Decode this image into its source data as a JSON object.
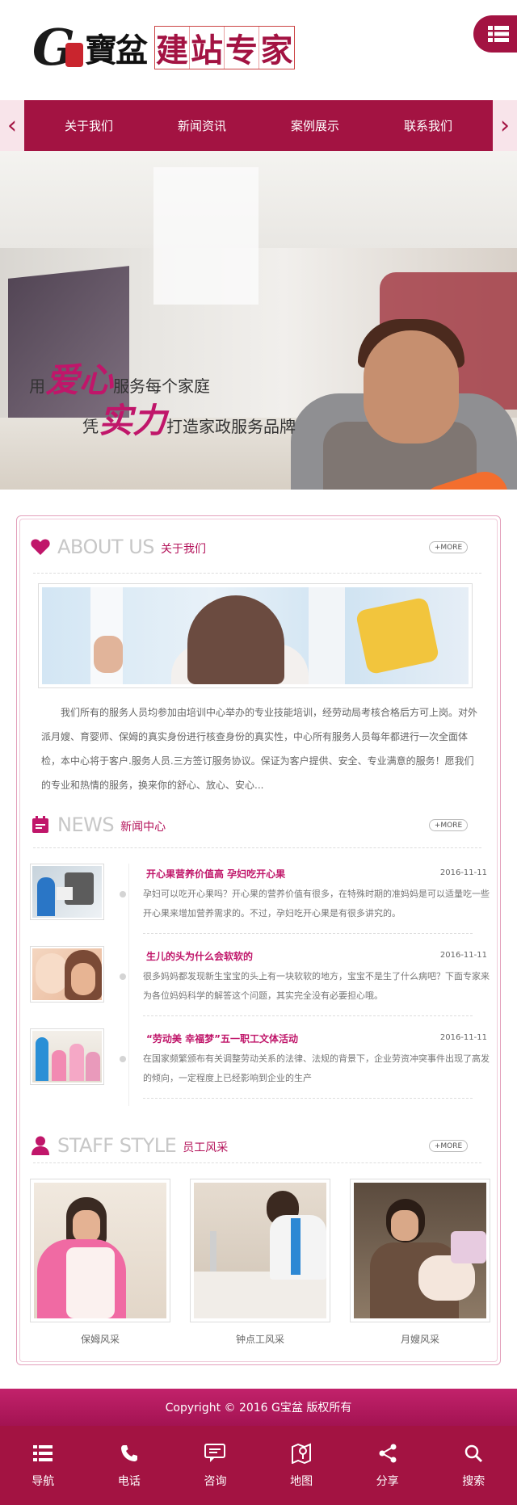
{
  "header": {
    "logo_letter": "G",
    "logo_bao": "寶盆",
    "logo_slogan_chars": [
      "建",
      "站",
      "专",
      "家"
    ]
  },
  "nav": {
    "items": [
      "关于我们",
      "新闻资讯",
      "案例展示",
      "联系我们"
    ],
    "prev_glyph": "‹",
    "next_glyph": "›"
  },
  "banner": {
    "line1_pre": "用",
    "line1_em": "爱心",
    "line1_post": "服务每个家庭",
    "line2_pre": "凭",
    "line2_em": "实力",
    "line2_post": "打造家政服务品牌"
  },
  "about": {
    "title_en": "ABOUT US",
    "title_cn": "关于我们",
    "more": "+MORE",
    "text": "我们所有的服务人员均参加由培训中心举办的专业技能培训，经劳动局考核合格后方可上岗。对外派月嫂、育婴师、保姆的真实身份进行核查身份的真实性，中心所有服务人员每年都进行一次全面体检，本中心将于客户.服务人员.三方签订服务协议。保证为客户提供、安全、专业满意的服务！愿我们的专业和热情的服务，换来你的舒心、放心、安心..."
  },
  "news": {
    "title_en": "NEWS",
    "title_cn": "新闻中心",
    "more": "+MORE",
    "items": [
      {
        "title": "开心果营养价值高 孕妇吃开心果",
        "date": "2016-11-11",
        "desc": "孕妇可以吃开心果吗？开心果的营养价值有很多，在特殊时期的准妈妈是可以适量吃一些开心果来增加营养需求的。不过，孕妇吃开心果是有很多讲究的。"
      },
      {
        "title": "生儿的头为什么会软软的",
        "date": "2016-11-11",
        "desc": "很多妈妈都发现新生宝宝的头上有一块软软的地方，宝宝不是生了什么病吧？下面专家来为各位妈妈科学的解答这个问题，其实完全没有必要担心哦。"
      },
      {
        "title": "“劳动美 幸福梦”五一职工文体活动",
        "date": "2016-11-11",
        "desc": "在国家频繁颁布有关调整劳动关系的法律、法规的背景下，企业劳资冲突事件出现了高发的倾向，一定程度上已经影响到企业的生产"
      }
    ]
  },
  "staff": {
    "title_en": "STAFF STYLE",
    "title_cn": "员工风采",
    "more": "+MORE",
    "items": [
      "保姆风采",
      "钟点工风采",
      "月嫂风采"
    ]
  },
  "footer": {
    "copyright": "Copyright © 2016 G宝盆 版权所有",
    "bottom_nav": [
      "导航",
      "电话",
      "咨询",
      "地图",
      "分享",
      "搜索"
    ]
  },
  "colors": {
    "brand": "#a31342",
    "accent": "#c0166a",
    "muted_title": "#c7c7c7"
  },
  "icons": [
    "menu-icon",
    "heart-icon",
    "calendar-icon",
    "person-icon",
    "grid-icon",
    "phone-icon",
    "chat-icon",
    "map-icon",
    "share-icon",
    "search-icon"
  ]
}
